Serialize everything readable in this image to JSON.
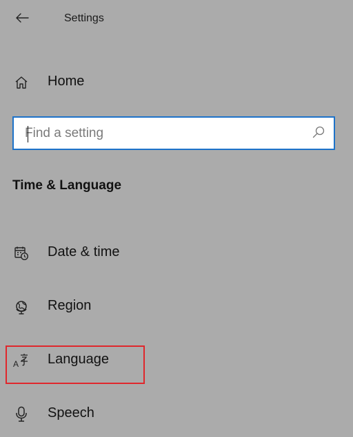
{
  "header": {
    "title": "Settings",
    "back_icon": "arrow-left-icon"
  },
  "home": {
    "label": "Home",
    "icon": "home-icon"
  },
  "search": {
    "value": "",
    "placeholder": "Find a setting",
    "icon": "search-icon",
    "focus_color": "#1d72c9"
  },
  "section": {
    "title": "Time & Language"
  },
  "nav": {
    "items": [
      {
        "label": "Date & time",
        "icon": "calendar-clock-icon"
      },
      {
        "label": "Region",
        "icon": "globe-icon"
      },
      {
        "label": "Language",
        "icon": "language-icon"
      },
      {
        "label": "Speech",
        "icon": "microphone-icon"
      }
    ]
  },
  "annotation": {
    "highlight_color": "#e0262b",
    "highlighted_item": "Language"
  },
  "colors": {
    "background": "#ababab"
  }
}
